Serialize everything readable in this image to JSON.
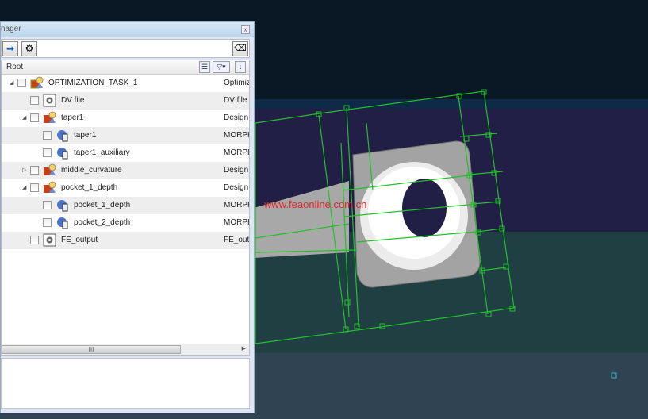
{
  "panel": {
    "title": "nager",
    "close": "x"
  },
  "toolbar": {
    "run": "run-arrow-icon",
    "settings": "gear-icon",
    "eraser": "eraser-icon"
  },
  "tree": {
    "root_label": "Root",
    "rows": [
      {
        "label": "OPTIMIZATION_TASK_1",
        "type": "Optimiz",
        "level": 0,
        "expand": "open",
        "icon": "task-icon"
      },
      {
        "label": "DV file",
        "type": "DV file",
        "level": 1,
        "expand": "none",
        "icon": "gear-icon"
      },
      {
        "label": "taper1",
        "type": "Design",
        "level": 1,
        "expand": "open",
        "icon": "design-icon"
      },
      {
        "label": "taper1",
        "type": "MORPH",
        "level": 2,
        "expand": "none",
        "icon": "morph-icon"
      },
      {
        "label": "taper1_auxiliary",
        "type": "MORPH",
        "level": 2,
        "expand": "none",
        "icon": "morph-icon"
      },
      {
        "label": "middle_curvature",
        "type": "Design",
        "level": 1,
        "expand": "closed",
        "icon": "design-icon"
      },
      {
        "label": "pocket_1_depth",
        "type": "Design",
        "level": 1,
        "expand": "open",
        "icon": "design-icon"
      },
      {
        "label": "pocket_1_depth",
        "type": "MORPH",
        "level": 2,
        "expand": "none",
        "icon": "morph-icon"
      },
      {
        "label": "pocket_2_depth",
        "type": "MORPH",
        "level": 2,
        "expand": "none",
        "icon": "morph-icon"
      },
      {
        "label": "FE_output",
        "type": "FE_out",
        "level": 1,
        "expand": "none",
        "icon": "gear-icon"
      }
    ],
    "scroll_grip": "III"
  },
  "viewport": {
    "watermark": "www.feaonline.com.cn",
    "mesh_color": "#22c02a",
    "part_color": "#a9a9a9"
  }
}
